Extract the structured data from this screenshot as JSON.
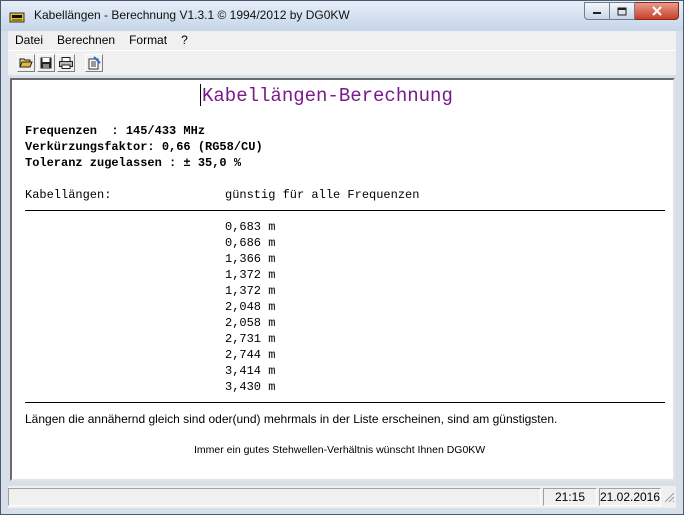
{
  "window": {
    "title": "Kabellängen - Berechnung V1.3.1 © 1994/2012 by DG0KW"
  },
  "menu": [
    "Datei",
    "Berechnen",
    "Format",
    "?"
  ],
  "toolbar": {
    "buttons": [
      "open-icon",
      "save-icon",
      "print-icon",
      "calculate-icon"
    ]
  },
  "document": {
    "heading": "Kabellängen-Berechnung",
    "lines": [
      "Frequenzen  : 145/433 MHz",
      "Verkürzungsfaktor: 0,66 (RG58/CU)",
      "Toleranz zugelassen : ± 35,0 %"
    ],
    "col_label": "Kabellängen:",
    "col_header": "günstig für alle Frequenzen",
    "lengths": [
      "0,683 m",
      "0,686 m",
      "1,366 m",
      "1,372 m",
      "1,372 m",
      "2,048 m",
      "2,058 m",
      "2,731 m",
      "2,744 m",
      "3,414 m",
      "3,430 m"
    ],
    "note": "Längen die annähernd gleich sind oder(und) mehrmals in der Liste erscheinen, sind am günstigsten.",
    "footer": "Immer ein gutes Stehwellen-Verhältnis wünscht Ihnen DG0KW"
  },
  "status": {
    "time": "21:15",
    "date": "21.02.2016"
  }
}
